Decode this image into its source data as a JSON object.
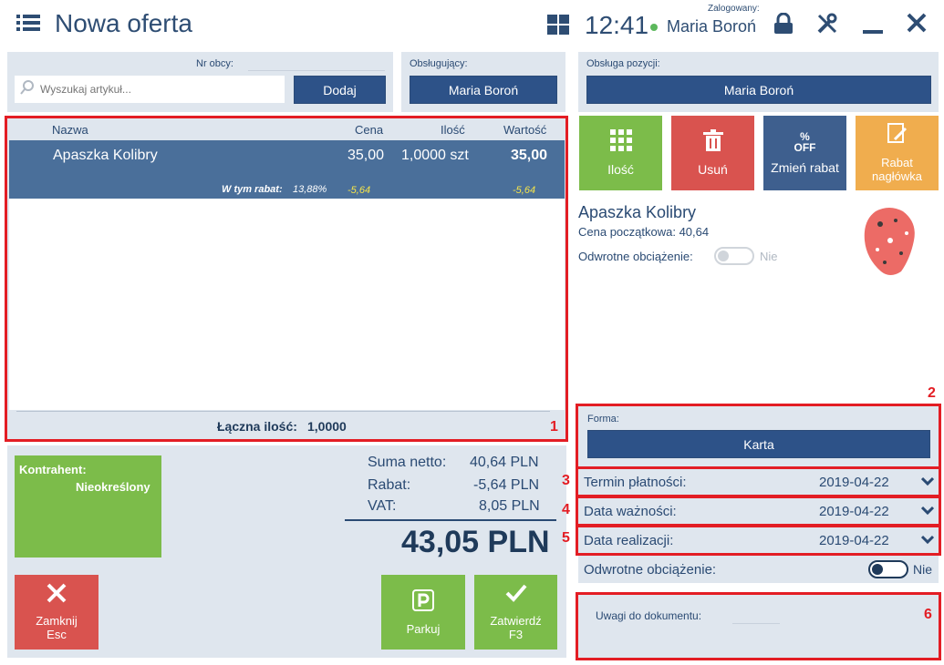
{
  "header": {
    "title": "Nowa oferta",
    "time": "12:41",
    "logged_label": "Zalogowany:",
    "user": "Maria Boroń"
  },
  "search": {
    "label": "Nr obcy:",
    "placeholder": "Wyszukaj artykuł...",
    "add": "Dodaj"
  },
  "handler": {
    "label": "Obsługujący:",
    "value": "Maria Boroń"
  },
  "pos_handler": {
    "label": "Obsługa pozycji:",
    "value": "Maria Boroń"
  },
  "table": {
    "headers": [
      "Nazwa",
      "Cena",
      "Ilość",
      "Wartość"
    ],
    "row": {
      "name": "Apaszka Kolibry",
      "price": "35,00",
      "qty": "1,0000 szt",
      "value": "35,00",
      "discount_label": "W tym rabat:",
      "discount_pct": "13,88%",
      "discount_price": "-5,64",
      "discount_value": "-5,64"
    },
    "total_label": "Łączna ilość:",
    "total_value": "1,0000"
  },
  "actions": {
    "qty": "Ilość",
    "delete": "Usuń",
    "change_discount": "Zmień rabat",
    "header_discount_1": "Rabat",
    "header_discount_2": "nagłówka",
    "off_pct": "%",
    "off": "OFF"
  },
  "item": {
    "name": "Apaszka Kolibry",
    "base_price": "Cena początkowa: 40,64",
    "reverse_label": "Odwrotne obciążenie:",
    "reverse_value": "Nie"
  },
  "payment": {
    "label": "Forma:",
    "value": "Karta"
  },
  "dates": {
    "term_label": "Termin płatności:",
    "term": "2019-04-22",
    "valid_label": "Data ważności:",
    "valid": "2019-04-22",
    "real_label": "Data realizacji:",
    "real": "2019-04-22"
  },
  "doc_reverse": {
    "label": "Odwrotne obciążenie:",
    "value": "Nie"
  },
  "notes": {
    "label": "Uwagi do dokumentu:"
  },
  "contractor": {
    "label": "Kontrahent:",
    "value": "Nieokreślony"
  },
  "summary": {
    "net_label": "Suma netto:",
    "net": "40,64 PLN",
    "disc_label": "Rabat:",
    "disc": "-5,64 PLN",
    "vat_label": "VAT:",
    "vat": "8,05 PLN",
    "total": "43,05 PLN"
  },
  "buttons": {
    "close": "Zamknij",
    "close_key": "Esc",
    "park": "Parkuj",
    "confirm": "Zatwierdź",
    "confirm_key": "F3"
  },
  "markers": [
    "1",
    "2",
    "3",
    "4",
    "5",
    "6"
  ],
  "colors": {
    "accent": "#2d5288",
    "green": "#7cbc4a",
    "red": "#d9534f",
    "orange": "#f0ad4e",
    "panel": "#dfe6ee"
  }
}
